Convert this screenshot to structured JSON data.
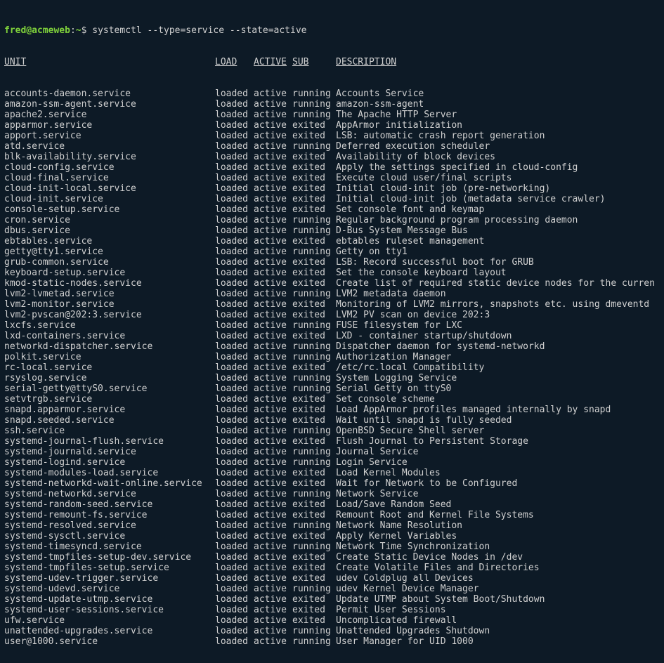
{
  "prompt": {
    "user": "fred",
    "host": "acmeweb",
    "path": "~",
    "symbol": "$",
    "command": "systemctl --type=service --state=active"
  },
  "headers": {
    "unit": "UNIT",
    "load": "LOAD",
    "active": "ACTIVE",
    "sub": "SUB",
    "description": "DESCRIPTION"
  },
  "services": [
    {
      "unit": "accounts-daemon.service",
      "load": "loaded",
      "active": "active",
      "sub": "running",
      "desc": "Accounts Service"
    },
    {
      "unit": "amazon-ssm-agent.service",
      "load": "loaded",
      "active": "active",
      "sub": "running",
      "desc": "amazon-ssm-agent"
    },
    {
      "unit": "apache2.service",
      "load": "loaded",
      "active": "active",
      "sub": "running",
      "desc": "The Apache HTTP Server"
    },
    {
      "unit": "apparmor.service",
      "load": "loaded",
      "active": "active",
      "sub": "exited",
      "desc": "AppArmor initialization"
    },
    {
      "unit": "apport.service",
      "load": "loaded",
      "active": "active",
      "sub": "exited",
      "desc": "LSB: automatic crash report generation"
    },
    {
      "unit": "atd.service",
      "load": "loaded",
      "active": "active",
      "sub": "running",
      "desc": "Deferred execution scheduler"
    },
    {
      "unit": "blk-availability.service",
      "load": "loaded",
      "active": "active",
      "sub": "exited",
      "desc": "Availability of block devices"
    },
    {
      "unit": "cloud-config.service",
      "load": "loaded",
      "active": "active",
      "sub": "exited",
      "desc": "Apply the settings specified in cloud-config"
    },
    {
      "unit": "cloud-final.service",
      "load": "loaded",
      "active": "active",
      "sub": "exited",
      "desc": "Execute cloud user/final scripts"
    },
    {
      "unit": "cloud-init-local.service",
      "load": "loaded",
      "active": "active",
      "sub": "exited",
      "desc": "Initial cloud-init job (pre-networking)"
    },
    {
      "unit": "cloud-init.service",
      "load": "loaded",
      "active": "active",
      "sub": "exited",
      "desc": "Initial cloud-init job (metadata service crawler)"
    },
    {
      "unit": "console-setup.service",
      "load": "loaded",
      "active": "active",
      "sub": "exited",
      "desc": "Set console font and keymap"
    },
    {
      "unit": "cron.service",
      "load": "loaded",
      "active": "active",
      "sub": "running",
      "desc": "Regular background program processing daemon"
    },
    {
      "unit": "dbus.service",
      "load": "loaded",
      "active": "active",
      "sub": "running",
      "desc": "D-Bus System Message Bus"
    },
    {
      "unit": "ebtables.service",
      "load": "loaded",
      "active": "active",
      "sub": "exited",
      "desc": "ebtables ruleset management"
    },
    {
      "unit": "getty@tty1.service",
      "load": "loaded",
      "active": "active",
      "sub": "running",
      "desc": "Getty on tty1"
    },
    {
      "unit": "grub-common.service",
      "load": "loaded",
      "active": "active",
      "sub": "exited",
      "desc": "LSB: Record successful boot for GRUB"
    },
    {
      "unit": "keyboard-setup.service",
      "load": "loaded",
      "active": "active",
      "sub": "exited",
      "desc": "Set the console keyboard layout"
    },
    {
      "unit": "kmod-static-nodes.service",
      "load": "loaded",
      "active": "active",
      "sub": "exited",
      "desc": "Create list of required static device nodes for the curren"
    },
    {
      "unit": "lvm2-lvmetad.service",
      "load": "loaded",
      "active": "active",
      "sub": "running",
      "desc": "LVM2 metadata daemon"
    },
    {
      "unit": "lvm2-monitor.service",
      "load": "loaded",
      "active": "active",
      "sub": "exited",
      "desc": "Monitoring of LVM2 mirrors, snapshots etc. using dmeventd"
    },
    {
      "unit": "lvm2-pvscan@202:3.service",
      "load": "loaded",
      "active": "active",
      "sub": "exited",
      "desc": "LVM2 PV scan on device 202:3"
    },
    {
      "unit": "lxcfs.service",
      "load": "loaded",
      "active": "active",
      "sub": "running",
      "desc": "FUSE filesystem for LXC"
    },
    {
      "unit": "lxd-containers.service",
      "load": "loaded",
      "active": "active",
      "sub": "exited",
      "desc": "LXD - container startup/shutdown"
    },
    {
      "unit": "networkd-dispatcher.service",
      "load": "loaded",
      "active": "active",
      "sub": "running",
      "desc": "Dispatcher daemon for systemd-networkd"
    },
    {
      "unit": "polkit.service",
      "load": "loaded",
      "active": "active",
      "sub": "running",
      "desc": "Authorization Manager"
    },
    {
      "unit": "rc-local.service",
      "load": "loaded",
      "active": "active",
      "sub": "exited",
      "desc": "/etc/rc.local Compatibility"
    },
    {
      "unit": "rsyslog.service",
      "load": "loaded",
      "active": "active",
      "sub": "running",
      "desc": "System Logging Service"
    },
    {
      "unit": "serial-getty@ttyS0.service",
      "load": "loaded",
      "active": "active",
      "sub": "running",
      "desc": "Serial Getty on ttyS0"
    },
    {
      "unit": "setvtrgb.service",
      "load": "loaded",
      "active": "active",
      "sub": "exited",
      "desc": "Set console scheme"
    },
    {
      "unit": "snapd.apparmor.service",
      "load": "loaded",
      "active": "active",
      "sub": "exited",
      "desc": "Load AppArmor profiles managed internally by snapd"
    },
    {
      "unit": "snapd.seeded.service",
      "load": "loaded",
      "active": "active",
      "sub": "exited",
      "desc": "Wait until snapd is fully seeded"
    },
    {
      "unit": "ssh.service",
      "load": "loaded",
      "active": "active",
      "sub": "running",
      "desc": "OpenBSD Secure Shell server"
    },
    {
      "unit": "systemd-journal-flush.service",
      "load": "loaded",
      "active": "active",
      "sub": "exited",
      "desc": "Flush Journal to Persistent Storage"
    },
    {
      "unit": "systemd-journald.service",
      "load": "loaded",
      "active": "active",
      "sub": "running",
      "desc": "Journal Service"
    },
    {
      "unit": "systemd-logind.service",
      "load": "loaded",
      "active": "active",
      "sub": "running",
      "desc": "Login Service"
    },
    {
      "unit": "systemd-modules-load.service",
      "load": "loaded",
      "active": "active",
      "sub": "exited",
      "desc": "Load Kernel Modules"
    },
    {
      "unit": "systemd-networkd-wait-online.service",
      "load": "loaded",
      "active": "active",
      "sub": "exited",
      "desc": "Wait for Network to be Configured"
    },
    {
      "unit": "systemd-networkd.service",
      "load": "loaded",
      "active": "active",
      "sub": "running",
      "desc": "Network Service"
    },
    {
      "unit": "systemd-random-seed.service",
      "load": "loaded",
      "active": "active",
      "sub": "exited",
      "desc": "Load/Save Random Seed"
    },
    {
      "unit": "systemd-remount-fs.service",
      "load": "loaded",
      "active": "active",
      "sub": "exited",
      "desc": "Remount Root and Kernel File Systems"
    },
    {
      "unit": "systemd-resolved.service",
      "load": "loaded",
      "active": "active",
      "sub": "running",
      "desc": "Network Name Resolution"
    },
    {
      "unit": "systemd-sysctl.service",
      "load": "loaded",
      "active": "active",
      "sub": "exited",
      "desc": "Apply Kernel Variables"
    },
    {
      "unit": "systemd-timesyncd.service",
      "load": "loaded",
      "active": "active",
      "sub": "running",
      "desc": "Network Time Synchronization"
    },
    {
      "unit": "systemd-tmpfiles-setup-dev.service",
      "load": "loaded",
      "active": "active",
      "sub": "exited",
      "desc": "Create Static Device Nodes in /dev"
    },
    {
      "unit": "systemd-tmpfiles-setup.service",
      "load": "loaded",
      "active": "active",
      "sub": "exited",
      "desc": "Create Volatile Files and Directories"
    },
    {
      "unit": "systemd-udev-trigger.service",
      "load": "loaded",
      "active": "active",
      "sub": "exited",
      "desc": "udev Coldplug all Devices"
    },
    {
      "unit": "systemd-udevd.service",
      "load": "loaded",
      "active": "active",
      "sub": "running",
      "desc": "udev Kernel Device Manager"
    },
    {
      "unit": "systemd-update-utmp.service",
      "load": "loaded",
      "active": "active",
      "sub": "exited",
      "desc": "Update UTMP about System Boot/Shutdown"
    },
    {
      "unit": "systemd-user-sessions.service",
      "load": "loaded",
      "active": "active",
      "sub": "exited",
      "desc": "Permit User Sessions"
    },
    {
      "unit": "ufw.service",
      "load": "loaded",
      "active": "active",
      "sub": "exited",
      "desc": "Uncomplicated firewall"
    },
    {
      "unit": "unattended-upgrades.service",
      "load": "loaded",
      "active": "active",
      "sub": "running",
      "desc": "Unattended Upgrades Shutdown"
    },
    {
      "unit": "user@1000.service",
      "load": "loaded",
      "active": "active",
      "sub": "running",
      "desc": "User Manager for UID 1000"
    }
  ]
}
